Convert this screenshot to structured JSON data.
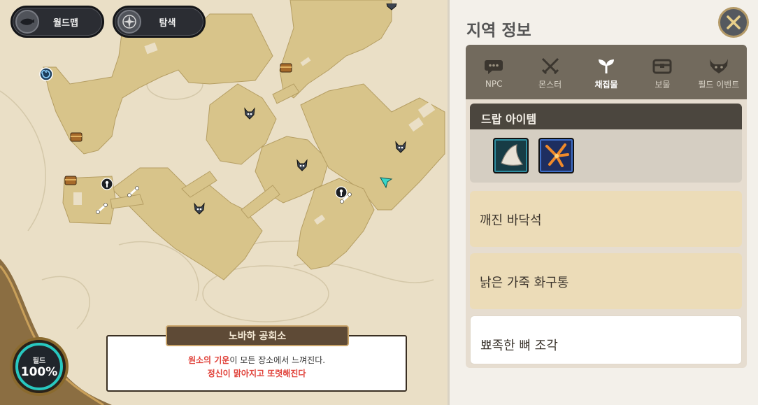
{
  "map": {
    "buttons": {
      "worldmap_label": "월드맵",
      "explore_label": "탐색"
    },
    "field_gauge": {
      "label": "필드",
      "percent": "100%"
    },
    "area": {
      "name": "노바하 공회소",
      "message_highlight": "원소의 기운",
      "message_rest": "이 모든 장소에서 느껴진다.",
      "message_line2": "정신이 맑아지고 또렷해진다"
    },
    "icons": [
      "wind-portal-icon",
      "chest-icon",
      "monster-icon",
      "keyhole-icon",
      "bone-icon",
      "player-arrow-icon"
    ]
  },
  "panel": {
    "title": "지역 정보",
    "tabs": [
      {
        "label": "NPC",
        "icon": "speech-bubble-icon"
      },
      {
        "label": "몬스터",
        "icon": "crossed-swords-icon"
      },
      {
        "label": "채집물",
        "icon": "sprout-icon",
        "active": true
      },
      {
        "label": "보물",
        "icon": "chest-icon"
      },
      {
        "label": "필드 이벤트",
        "icon": "horned-skull-icon"
      }
    ],
    "drop_section": {
      "header": "드랍 아이템",
      "items": [
        "claw-item-icon",
        "feather-item-icon"
      ]
    },
    "list": [
      {
        "label": "깨진 바닥석"
      },
      {
        "label": "낡은 가죽 화구통"
      },
      {
        "label": "뾰족한 뼈 조각"
      }
    ]
  },
  "colors": {
    "map_walkable": "#d8c48a",
    "panel_tab_bg": "#726a5d",
    "accent_teal": "#28c8c0",
    "message_red": "#e0423a"
  }
}
